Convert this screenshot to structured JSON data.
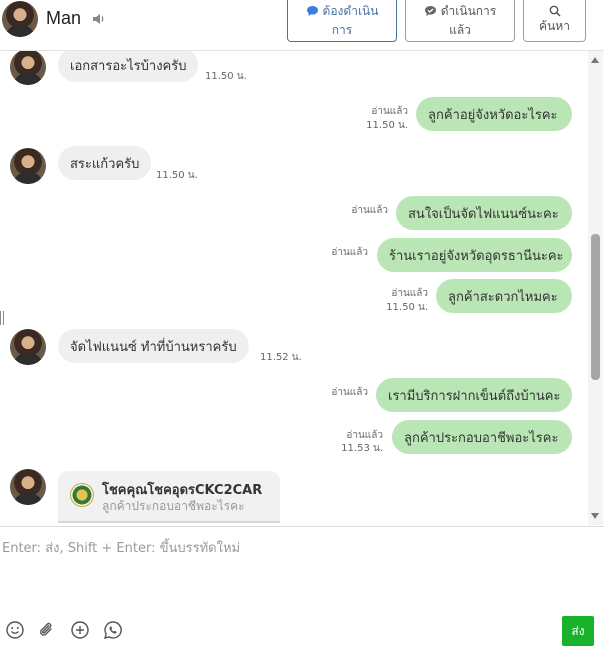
{
  "header": {
    "contact_name": "Man",
    "buttons": {
      "todo_line1": "ต้องดำเนิน",
      "todo_line2": "การ",
      "done_line1": "ดำเนินการ",
      "done_line2": "แล้ว",
      "search_label": "ค้นหา"
    },
    "icons": [
      "speaker-icon",
      "chat-bubble-icon",
      "chat-check-icon",
      "search-icon"
    ]
  },
  "messages": [
    {
      "direction": "in",
      "text": "เอกสารอะไรบ้างครับ",
      "time": "11.50 น."
    },
    {
      "direction": "out",
      "text": "ลูกค้าอยู่จังหวัดอะไรคะ",
      "read": "อ่านแล้ว",
      "time": "11.50 น."
    },
    {
      "direction": "in",
      "text": "สระแก้วครับ",
      "time": "11.50 น."
    },
    {
      "direction": "out",
      "text": "สนใจเป็นจัดไฟแนนซ์นะคะ",
      "read": "อ่านแล้ว",
      "time": ""
    },
    {
      "direction": "out",
      "text": "ร้านเราอยู่จังหวัดอุดรธานีนะคะ",
      "read": "อ่านแล้ว",
      "time": ""
    },
    {
      "direction": "out",
      "text": "ลูกค้าสะดวกไหมคะ",
      "read": "อ่านแล้ว",
      "time": "11.50 น."
    },
    {
      "direction": "in",
      "text": "จัดไฟแนนซ์ ทำที่บ้านหราครับ",
      "time": "11.52 น."
    },
    {
      "direction": "out",
      "text": "เรามีบริการฝากเข็นต์ถึงบ้านคะ",
      "read": "อ่านแล้ว",
      "time": ""
    },
    {
      "direction": "out",
      "text": "ลูกค้าประกอบอาชีพอะไรคะ",
      "read": "อ่านแล้ว",
      "time": "11.53 น."
    }
  ],
  "card": {
    "title": "โชคคุณโชคอุดรCKC2CAR",
    "subtitle": "ลูกค้าประกอบอาชีพอะไรคะ"
  },
  "composer": {
    "placeholder": "Enter: ส่ง, Shift + Enter: ขึ้นบรรทัดใหม่",
    "value": "",
    "send_label": "ส่ง",
    "tools": [
      "emoji-icon",
      "attachment-icon",
      "add-icon",
      "whatsapp-icon"
    ]
  },
  "colors": {
    "outgoing_bubble": "#b9e6b4",
    "incoming_bubble": "#efefef",
    "send_button": "#19b32b",
    "accent": "#4a6fa5"
  }
}
